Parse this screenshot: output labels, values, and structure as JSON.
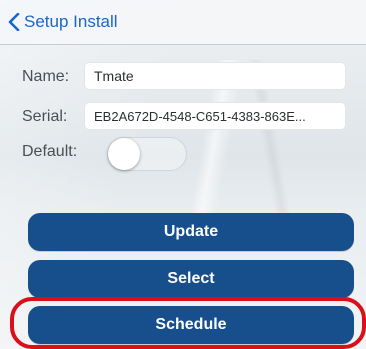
{
  "nav": {
    "back_label": "Setup Install",
    "back_icon": "chevron-left-icon"
  },
  "form": {
    "name_label": "Name:",
    "name_value": "Tmate",
    "serial_label": "Serial:",
    "serial_value": "EB2A672D-4548-C651-4383-863E...",
    "default_label": "Default:",
    "default_on": false
  },
  "actions": {
    "update_label": "Update",
    "select_label": "Select",
    "schedule_label": "Schedule"
  },
  "colors": {
    "accent": "#1a65c8",
    "button": "#174f8c",
    "highlight": "#d90f1a"
  }
}
